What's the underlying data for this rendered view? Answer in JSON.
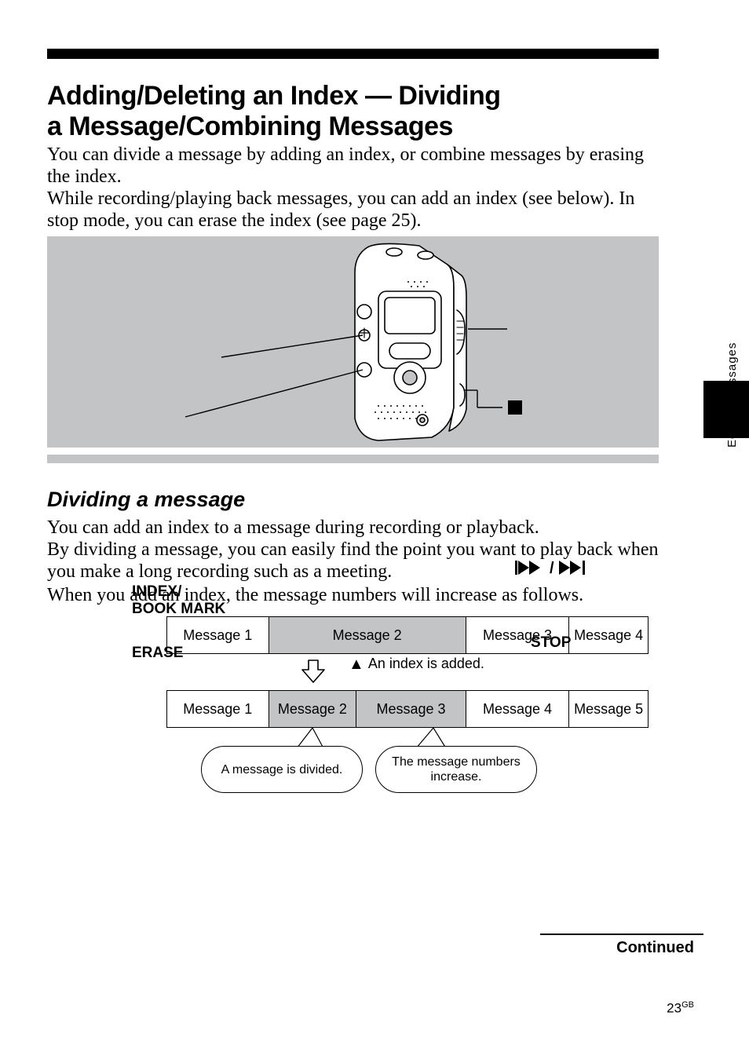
{
  "sideText": "Editing Messages",
  "title_line1": "Adding/Deleting an Index — Dividing",
  "title_line2": "a Message/Combining Messages",
  "intro1": "You can divide a message by adding an index, or combine messages by erasing the index.",
  "intro2": "While recording/playing back messages, you can add an index (see below).  In stop mode, you can erase the index (see page 25).",
  "illus": {
    "index": "INDEX/\nBOOK MARK",
    "erase": "ERASE",
    "stop": "STOP"
  },
  "subhead": "Dividing a message",
  "body1": "You can add an index to a message during recording or playback.\nBy dividing a message, you can easily find the point you want to play back when you make a long recording such as a meeting.",
  "body2": "When you add an index, the message numbers will increase as follows.",
  "diagram": {
    "row1": [
      "Message 1",
      "Message 2",
      "Message 3",
      "Message 4"
    ],
    "row2": [
      "Message 1",
      "Message 2",
      "Message 3",
      "Message 4",
      "Message 5"
    ],
    "marker": "An index is added.",
    "bubble1": "A message is divided.",
    "bubble2": "The message numbers increase."
  },
  "continued": "Continued",
  "pageNum": "23",
  "pageNumSuffix": "GB"
}
